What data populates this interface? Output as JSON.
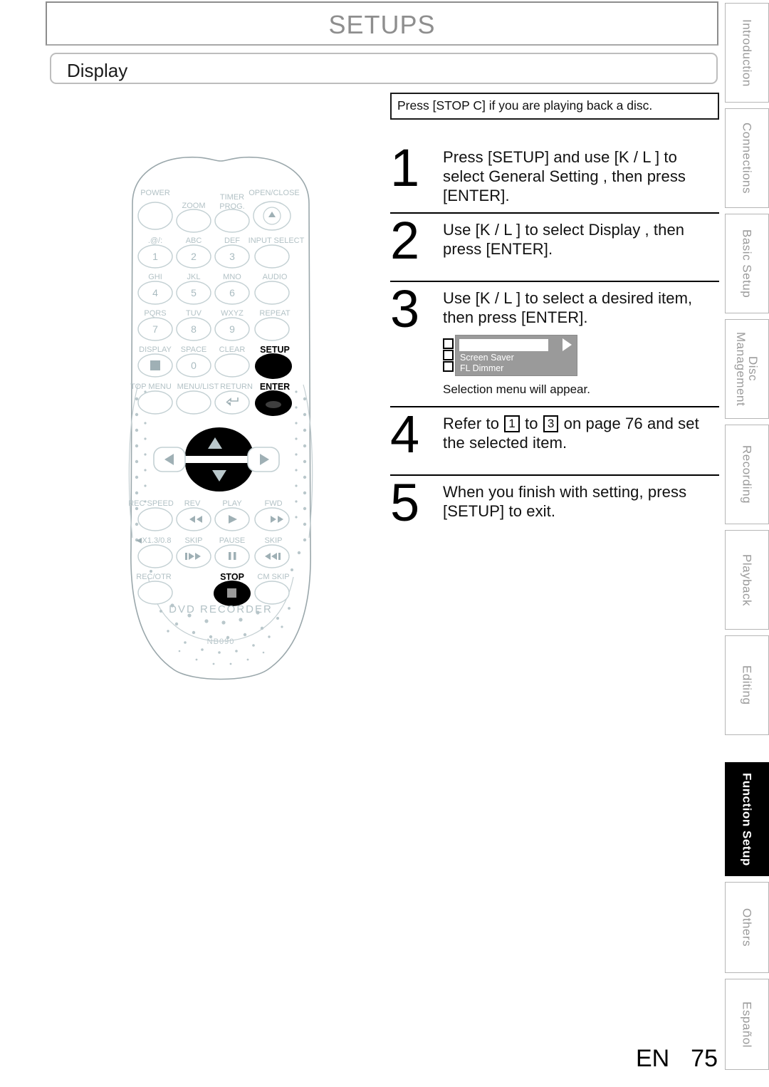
{
  "header": {
    "title": "SETUPS",
    "section": "Display"
  },
  "note": {
    "text": "Press [STOP C] if you are playing back a disc."
  },
  "steps": [
    {
      "number": "1",
      "text": "Press [SETUP] and use [K / L ] to select  General Setting , then press [ENTER]."
    },
    {
      "number": "2",
      "text": "Use [K / L ] to select  Display , then press [ENTER]."
    },
    {
      "number": "3",
      "text": "Use [K / L ] to select a desired item, then press [ENTER].",
      "caption": "Selection menu will appear.",
      "osd": {
        "items": [
          "Screen Saver",
          "FL Dimmer"
        ],
        "panel_color": "#9a9a9a",
        "selected_color": "#ffffff"
      }
    },
    {
      "number": "4",
      "text_before": "Refer to",
      "ref_from": "1",
      "text_middle": "to",
      "ref_to": "3",
      "text_after": "on page 76 and set the selected item."
    },
    {
      "number": "5",
      "text": "When you finish with setting, press [SETUP] to exit."
    }
  ],
  "tabs": [
    {
      "label": "Introduction",
      "active": false
    },
    {
      "label": "Connections",
      "active": false
    },
    {
      "label": "Basic Setup",
      "active": false
    },
    {
      "label": "Disc Management",
      "active": false
    },
    {
      "label": "Recording",
      "active": false
    },
    {
      "label": "Playback",
      "active": false
    },
    {
      "label": "Editing",
      "active": false
    },
    {
      "label": "Function Setup",
      "active": true
    },
    {
      "label": "Others",
      "active": false
    },
    {
      "label": "Español",
      "active": false
    }
  ],
  "remote": {
    "brand": "DVD RECORDER",
    "model": "NB090",
    "labels": {
      "power": "POWER",
      "zoom": "ZOOM",
      "timer_prog_line1": "TIMER",
      "timer_prog_line2": "PROG.",
      "open_close": "OPEN/CLOSE",
      "key1_alpha": ".@/:",
      "key2_alpha": "ABC",
      "key3_alpha": "DEF",
      "input_select": "INPUT SELECT",
      "key4_alpha": "GHI",
      "key5_alpha": "JKL",
      "key6_alpha": "MNO",
      "audio": "AUDIO",
      "key7_alpha": "PQRS",
      "key8_alpha": "TUV",
      "key9_alpha": "WXYZ",
      "repeat": "REPEAT",
      "display": "DISPLAY",
      "space": "SPACE",
      "clear": "CLEAR",
      "setup": "SETUP",
      "top_menu": "TOP MENU",
      "menu_list": "MENU/LIST",
      "return": "RETURN",
      "enter": "ENTER",
      "rec_speed": "REC SPEED",
      "rev": "REV",
      "play": "PLAY",
      "fwd": "FWD",
      "speed_x": "X1.3/0.8",
      "skip_back": "SKIP",
      "pause": "PAUSE",
      "skip_fwd": "SKIP",
      "rec_otr": "REC/OTR",
      "stop": "STOP",
      "cm_skip": "CM SKIP",
      "num1": "1",
      "num2": "2",
      "num3": "3",
      "num4": "4",
      "num5": "5",
      "num6": "6",
      "num7": "7",
      "num8": "8",
      "num9": "9",
      "num0": "0"
    }
  },
  "footer": {
    "lang": "EN",
    "page": "75"
  }
}
